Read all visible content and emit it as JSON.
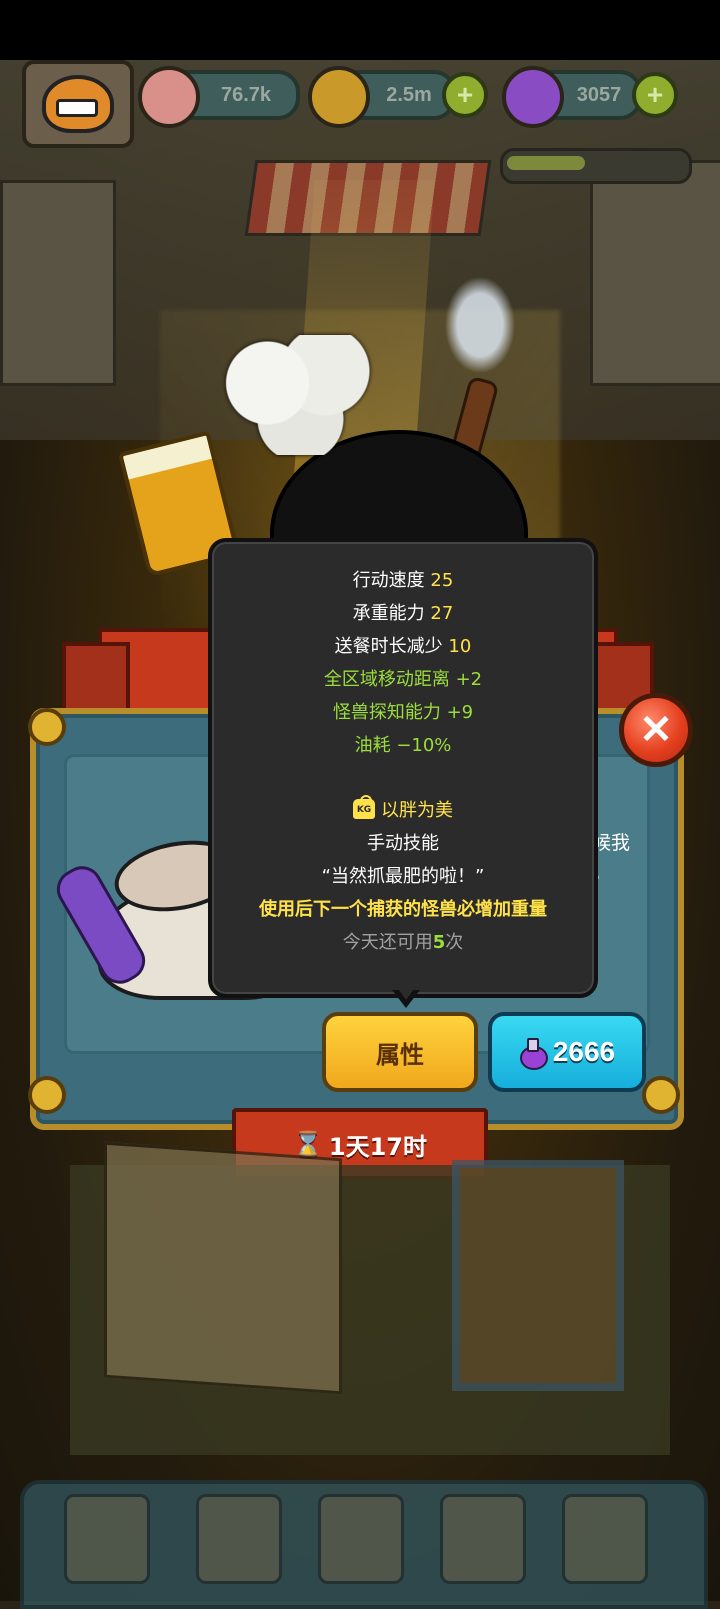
{
  "hud": {
    "eyeball_value": "76.7k",
    "coin_value": "2.5m",
    "potion_value": "3057",
    "plus_label": "+"
  },
  "colors": {
    "accent_yellow": "#ffe24a",
    "accent_green": "#9bdd3c",
    "button_yellow": "#f0a81c",
    "button_cyan": "#16aedb",
    "ribbon_red": "#c6391d",
    "panel_teal": "#3d6d7c"
  },
  "tooltip": {
    "stats": [
      {
        "label": "行动速度",
        "value": "25"
      },
      {
        "label": "承重能力",
        "value": "27"
      },
      {
        "label": "送餐时长减少",
        "value": "10"
      }
    ],
    "bonuses": [
      "全区域移动距离 +2",
      "怪兽探知能力 +9",
      "油耗 −10%"
    ],
    "skill": {
      "icon": "weight-kg-icon",
      "icon_text": "KG",
      "name": "以胖为美",
      "type": "手动技能",
      "quote": "“当然抓最肥的啦！”",
      "effect": "使用后下一个捕获的怪兽必增加重量",
      "uses_prefix": "今天还可用",
      "uses_count": "5",
      "uses_suffix": "次"
    }
  },
  "panel": {
    "side_text_1": "候我",
    "side_text_2": "。",
    "attr_button": "属性",
    "price": "2666",
    "timer_icon": "⌛",
    "timer": "1天17时"
  },
  "close_label": "✕"
}
